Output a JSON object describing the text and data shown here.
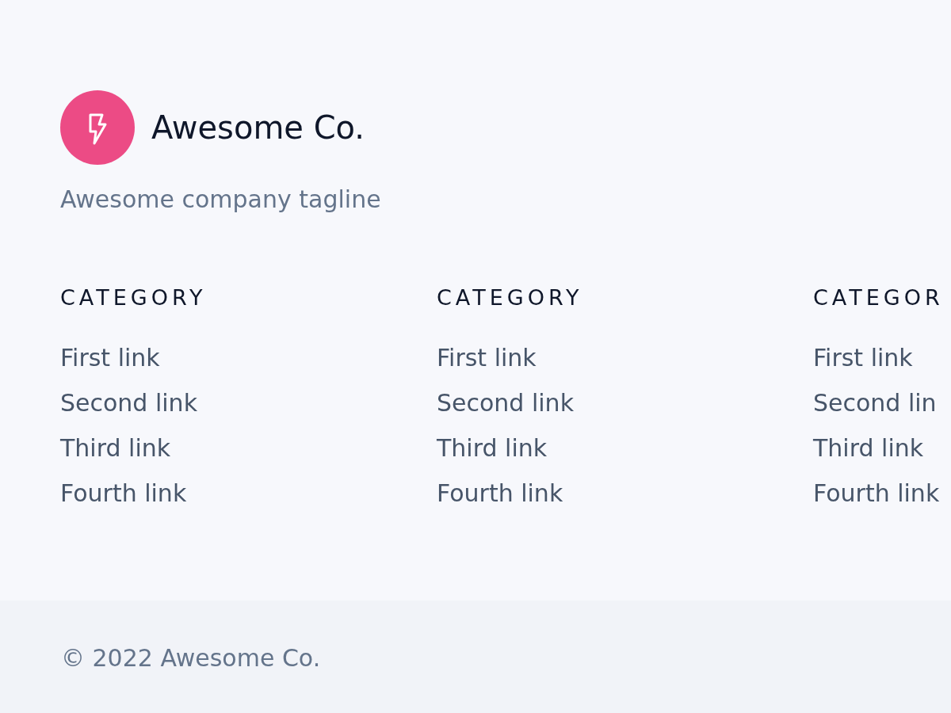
{
  "brand": {
    "name": "Awesome Co.",
    "tagline": "Awesome company tagline"
  },
  "columns": [
    {
      "heading": "CATEGORY",
      "links": [
        "First link",
        "Second link",
        "Third link",
        "Fourth link"
      ]
    },
    {
      "heading": "CATEGORY",
      "links": [
        "First link",
        "Second link",
        "Third link",
        "Fourth link"
      ]
    },
    {
      "heading": "CATEGOR",
      "links": [
        "First link",
        "Second lin",
        "Third link",
        "Fourth link"
      ]
    }
  ],
  "copyright": "© 2022 Awesome Co."
}
